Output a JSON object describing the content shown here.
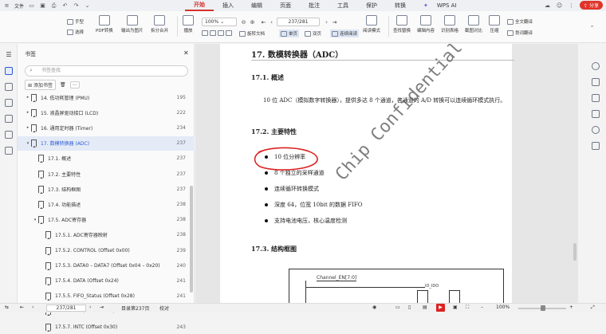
{
  "titlebar": {
    "file_label": "文件",
    "menus": [
      "开始",
      "插入",
      "编辑",
      "页面",
      "批注",
      "工具",
      "保护",
      "转换"
    ],
    "active_menu": "开始",
    "wps_ai": "WPS AI",
    "share": "分享"
  },
  "toolbar": {
    "hand": "手型",
    "select": "选择",
    "pdf_convert": "PDF转换",
    "export_image": "输出为图片",
    "split_merge": "拆分合并",
    "play": "播放",
    "zoom": "100%",
    "page_input": "237/281",
    "rotate_doc": "旋转文档",
    "single_page": "单页",
    "double_page": "双页",
    "continuous": "连续阅读",
    "read_mode": "阅读模式",
    "find_replace": "查找替换",
    "edit_content": "编辑内容",
    "recognize_table": "识别表格",
    "screenshot_compare": "截图对比",
    "compress": "压缩",
    "full_translate": "全文翻译",
    "translate_selected": "划词翻译"
  },
  "sidebar": {
    "title": "书签",
    "search_placeholder": "书签查找",
    "add_bookmark": "添加书签",
    "items": [
      {
        "label": "14. 低功耗管理 (PMU)",
        "page": "195",
        "arrow": "▸"
      },
      {
        "label": "15. 液晶屏驱动接口 (LCD)",
        "page": "222",
        "arrow": "▸"
      },
      {
        "label": "16. 通用定时器 (Timer)",
        "page": "234",
        "arrow": "▸"
      },
      {
        "label": "17. 数模转换器 (ADC)",
        "page": "237",
        "arrow": "▾"
      },
      {
        "label": "17.1. 概述",
        "page": "237",
        "arrow": ""
      },
      {
        "label": "17.2. 主要特性",
        "page": "237",
        "arrow": ""
      },
      {
        "label": "17.3. 结构框图",
        "page": "237",
        "arrow": ""
      },
      {
        "label": "17.4. 功能描述",
        "page": "238",
        "arrow": ""
      },
      {
        "label": "17.5. ADC寄存器",
        "page": "238",
        "arrow": "▾"
      },
      {
        "label": "17.5.1. ADC寄存器映射",
        "page": "238",
        "arrow": ""
      },
      {
        "label": "17.5.2. CONTROL (Offset 0x00)",
        "page": "239",
        "arrow": ""
      },
      {
        "label": "17.5.3. DATA0 – DATA7 (Offset 0x04 – 0x20)",
        "page": "240",
        "arrow": ""
      },
      {
        "label": "17.5.4. DATA (Offset 0x24)",
        "page": "241",
        "arrow": ""
      },
      {
        "label": "17.5.5. FIFO_Status (Offset 0x28)",
        "page": "241",
        "arrow": ""
      },
      {
        "label": "17.5.6. INT (Offset 0x2C)",
        "page": "242",
        "arrow": ""
      },
      {
        "label": "17.5.7. INTC (Offset 0x30)",
        "page": "243",
        "arrow": ""
      }
    ]
  },
  "document": {
    "heading": "17. 数模转换器（ADC）",
    "sec1": "17.1. 概述",
    "overview": "10 位 ADC（模拟数字转换器），提供多达 8 个通道，各通道的 A/D 转换可以连续循环模式执行。",
    "sec2": "17.2. 主要特性",
    "features": [
      "10 位分辨率",
      "8 个独立的采样通道",
      "连续循环转换模式",
      "深度 64，位宽 10bit 的数据 FIFO",
      "支持电池电压，核心温度检测"
    ],
    "sec3": "17.3. 结构框图",
    "diagram_signal": "Channel_EN[7:0]",
    "diagram_io": "IO_IDO",
    "watermark": "Chip Confidential"
  },
  "statusbar": {
    "page": "237/281",
    "bookmark": "目录第237页",
    "proof": "校对",
    "zoom": "100%"
  }
}
